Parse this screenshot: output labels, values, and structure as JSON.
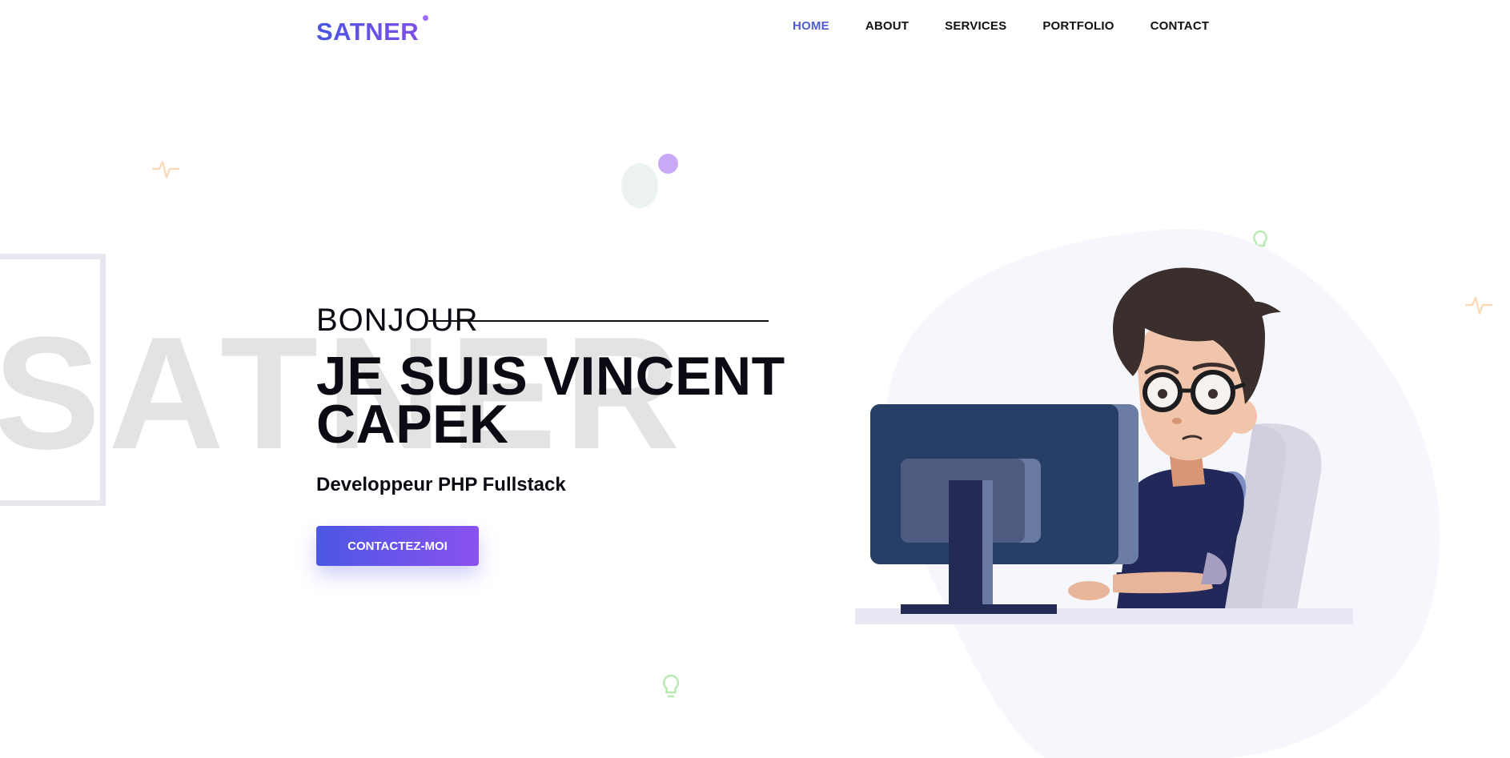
{
  "header": {
    "logo": "SATNER",
    "nav": [
      {
        "label": "HOME",
        "active": true
      },
      {
        "label": "ABOUT",
        "active": false
      },
      {
        "label": "SERVICES",
        "active": false
      },
      {
        "label": "PORTFOLIO",
        "active": false
      },
      {
        "label": "CONTACT",
        "active": false
      }
    ]
  },
  "background": {
    "watermark_text": "SATNER"
  },
  "hero": {
    "greeting": "BONJOUR",
    "title_line1": "JE SUIS VINCENT",
    "title_line2": "CAPEK",
    "subtitle": "Developpeur PHP Fullstack",
    "cta_label": "CONTACTEZ-MOI"
  },
  "decorations": {
    "icons": [
      "pulse-icon",
      "pulse-icon",
      "lightbulb-icon",
      "lightbulb-icon"
    ],
    "illustration": "developer-at-computer-illustration"
  },
  "colors": {
    "accent": "#4f5bd5",
    "gradient_start": "#4b57e3",
    "gradient_end": "#8a52f0"
  }
}
